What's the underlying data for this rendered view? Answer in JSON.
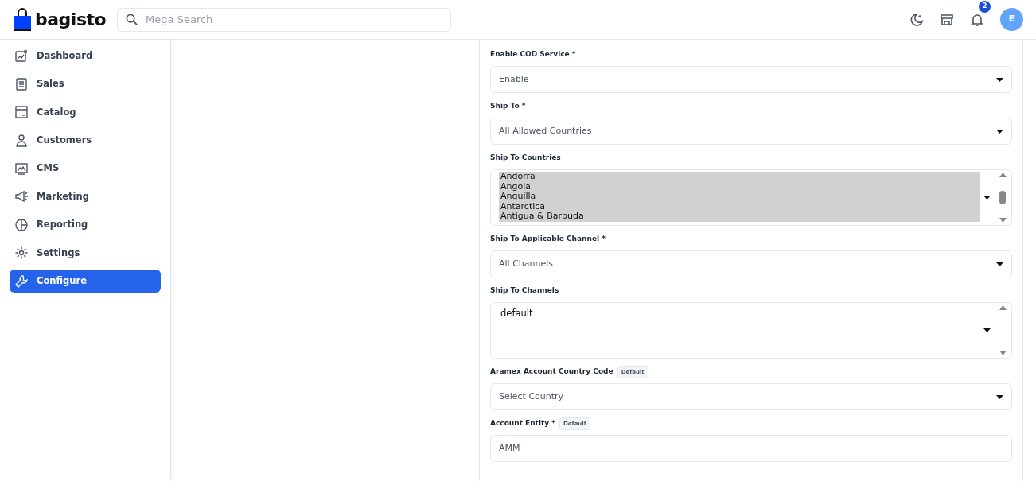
{
  "header": {
    "logo": "bagisto",
    "search": {
      "placeholder": "Mega Search"
    },
    "notifications": "2",
    "avatar": "E"
  },
  "sidebar": {
    "items": [
      {
        "label": "Dashboard",
        "selected": false
      },
      {
        "label": "Sales",
        "selected": false
      },
      {
        "label": "Catalog",
        "selected": false
      },
      {
        "label": "Customers",
        "selected": false
      },
      {
        "label": "CMS",
        "selected": false
      },
      {
        "label": "Marketing",
        "selected": false
      },
      {
        "label": "Reporting",
        "selected": false
      },
      {
        "label": "Settings",
        "selected": false
      },
      {
        "label": "Configure",
        "selected": true
      }
    ]
  },
  "fields": [
    {
      "kind": "select",
      "label": "Enable COD Service *",
      "value": "Enable"
    },
    {
      "kind": "select",
      "label": "Ship To *",
      "value": "All Allowed Countries"
    },
    {
      "kind": "multiselect",
      "label": "Ship To Countries",
      "options": [
        {
          "label": "Andorra",
          "selected": true
        },
        {
          "label": "Angola",
          "selected": true
        },
        {
          "label": "Anguilla",
          "selected": true
        },
        {
          "label": "Antarctica",
          "selected": true
        },
        {
          "label": "Antigua & Barbuda",
          "selected": true
        }
      ]
    },
    {
      "kind": "select",
      "label": "Ship To Applicable Channel *",
      "value": "All Channels"
    },
    {
      "kind": "multiselect",
      "label": "Ship To Channels",
      "options": [
        {
          "label": "default",
          "selected": false
        }
      ]
    },
    {
      "kind": "select",
      "label": "Aramex Account Country Code",
      "badge": "Default",
      "value": "Select Country"
    },
    {
      "kind": "text",
      "label": "Account Entity *",
      "badge": "Default",
      "value": "AMM"
    }
  ]
}
